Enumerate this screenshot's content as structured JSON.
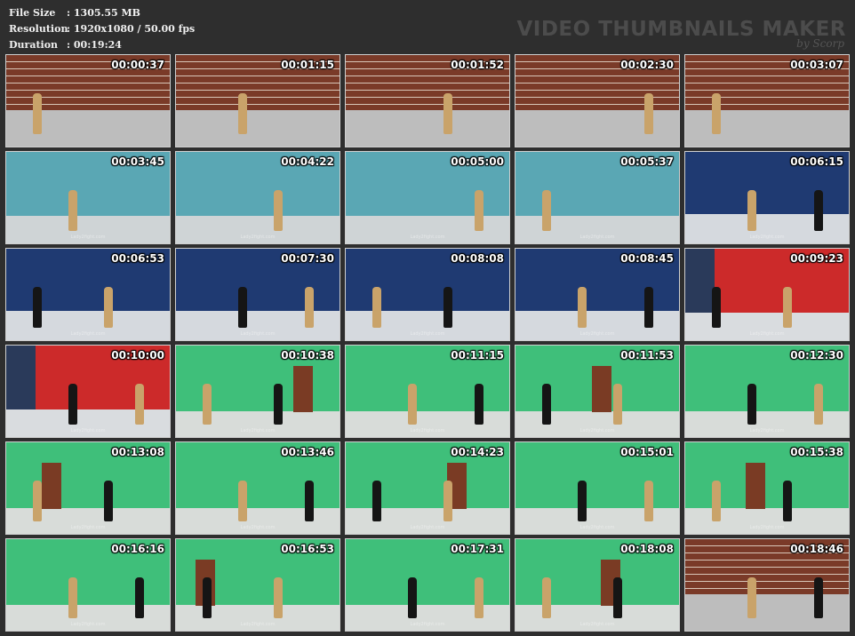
{
  "info": {
    "file_size_label": "File Size",
    "file_size_value": ": 1305.55 MB",
    "resolution_label": "Resolution",
    "resolution_value": ": 1920x1080 / 50.00 fps",
    "duration_label": "Duration",
    "duration_value": ": 00:19:24"
  },
  "brand": {
    "title": "VIDEO THUMBNAILS MAKER",
    "by": "by Scorp"
  },
  "watermark": "Lady2fight.com",
  "thumbnails": [
    {
      "time": "00:00:37",
      "scene": "brick"
    },
    {
      "time": "00:01:15",
      "scene": "brick"
    },
    {
      "time": "00:01:52",
      "scene": "brick"
    },
    {
      "time": "00:02:30",
      "scene": "brick"
    },
    {
      "time": "00:03:07",
      "scene": "brick"
    },
    {
      "time": "00:03:45",
      "scene": "teal"
    },
    {
      "time": "00:04:22",
      "scene": "teal"
    },
    {
      "time": "00:05:00",
      "scene": "teal"
    },
    {
      "time": "00:05:37",
      "scene": "teal"
    },
    {
      "time": "00:06:15",
      "scene": "navy"
    },
    {
      "time": "00:06:53",
      "scene": "navy"
    },
    {
      "time": "00:07:30",
      "scene": "navy"
    },
    {
      "time": "00:08:08",
      "scene": "navy"
    },
    {
      "time": "00:08:45",
      "scene": "navy"
    },
    {
      "time": "00:09:23",
      "scene": "red"
    },
    {
      "time": "00:10:00",
      "scene": "red"
    },
    {
      "time": "00:10:38",
      "scene": "green"
    },
    {
      "time": "00:11:15",
      "scene": "green"
    },
    {
      "time": "00:11:53",
      "scene": "green"
    },
    {
      "time": "00:12:30",
      "scene": "green"
    },
    {
      "time": "00:13:08",
      "scene": "green"
    },
    {
      "time": "00:13:46",
      "scene": "green"
    },
    {
      "time": "00:14:23",
      "scene": "green"
    },
    {
      "time": "00:15:01",
      "scene": "green"
    },
    {
      "time": "00:15:38",
      "scene": "green"
    },
    {
      "time": "00:16:16",
      "scene": "green"
    },
    {
      "time": "00:16:53",
      "scene": "green"
    },
    {
      "time": "00:17:31",
      "scene": "green"
    },
    {
      "time": "00:18:08",
      "scene": "green"
    },
    {
      "time": "00:18:46",
      "scene": "brick"
    }
  ]
}
